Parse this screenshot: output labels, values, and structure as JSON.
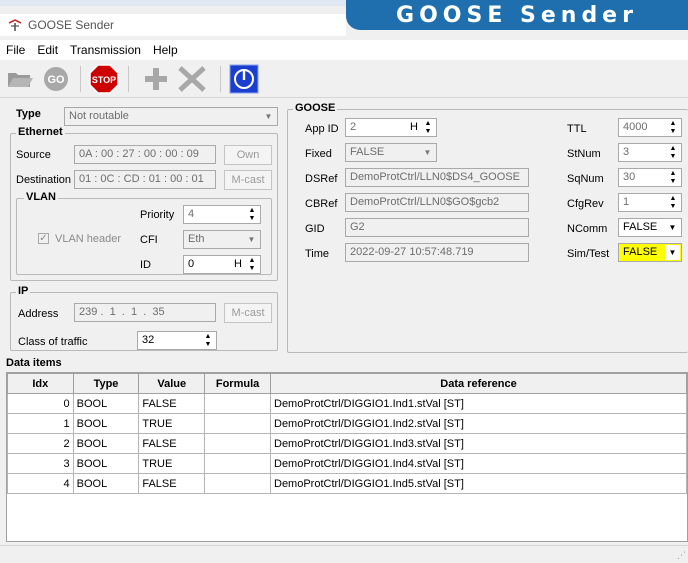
{
  "banner": "GOOSE Sender",
  "window_title": "GOOSE Sender",
  "menu": [
    "File",
    "Edit",
    "Transmission",
    "Help"
  ],
  "toolbar": {
    "open": "folder-open-icon",
    "go_label": "GO",
    "stop_label": "STOP",
    "add": "plus-icon",
    "remove": "x-icon",
    "power": "power-icon"
  },
  "type": {
    "label": "Type",
    "value": "Not routable"
  },
  "ethernet": {
    "title": "Ethernet",
    "source_label": "Source",
    "source_value": "0A : 00 : 27 : 00 : 00 : 09",
    "own_button": "Own",
    "destination_label": "Destination",
    "destination_value": "01 : 0C : CD : 01 : 00 : 01",
    "mcast_button": "M-cast"
  },
  "vlan": {
    "title": "VLAN",
    "header_label": "VLAN header",
    "priority_label": "Priority",
    "priority_value": "4",
    "cfi_label": "CFI",
    "cfi_value": "Eth",
    "id_label": "ID",
    "id_value": "0",
    "id_suffix": "H"
  },
  "ip": {
    "title": "IP",
    "address_label": "Address",
    "address_value": "239 .  1  .  1  .  35",
    "mcast_button": "M-cast",
    "class_label": "Class of traffic",
    "class_value": "32"
  },
  "goose": {
    "title": "GOOSE",
    "appid_label": "App ID",
    "appid_value": "2",
    "appid_suffix": "H",
    "fixed_label": "Fixed",
    "fixed_value": "FALSE",
    "dsref_label": "DSRef",
    "dsref_value": "DemoProtCtrl/LLN0$DS4_GOOSE",
    "cbref_label": "CBRef",
    "cbref_value": "DemoProtCtrl/LLN0$GO$gcb2",
    "gid_label": "GID",
    "gid_value": "G2",
    "time_label": "Time",
    "time_value": "2022-09-27 10:57:48.719",
    "ttl_label": "TTL",
    "ttl_value": "4000",
    "stnum_label": "StNum",
    "stnum_value": "3",
    "sqnum_label": "SqNum",
    "sqnum_value": "30",
    "cfgrev_label": "CfgRev",
    "cfgrev_value": "1",
    "ncomm_label": "NComm",
    "ncomm_value": "FALSE",
    "simtest_label": "Sim/Test",
    "simtest_value": "FALSE"
  },
  "data_items": {
    "title": "Data items",
    "columns": [
      "Idx",
      "Type",
      "Value",
      "Formula",
      "Data reference"
    ],
    "rows": [
      {
        "idx": "0",
        "type": "BOOL",
        "value": "FALSE",
        "formula": "",
        "ref": "DemoProtCtrl/DIGGIO1.Ind1.stVal [ST]"
      },
      {
        "idx": "1",
        "type": "BOOL",
        "value": "TRUE",
        "formula": "",
        "ref": "DemoProtCtrl/DIGGIO1.Ind2.stVal [ST]"
      },
      {
        "idx": "2",
        "type": "BOOL",
        "value": "FALSE",
        "formula": "",
        "ref": "DemoProtCtrl/DIGGIO1.Ind3.stVal [ST]"
      },
      {
        "idx": "3",
        "type": "BOOL",
        "value": "TRUE",
        "formula": "",
        "ref": "DemoProtCtrl/DIGGIO1.Ind4.stVal [ST]"
      },
      {
        "idx": "4",
        "type": "BOOL",
        "value": "FALSE",
        "formula": "",
        "ref": "DemoProtCtrl/DIGGIO1.Ind5.stVal [ST]"
      }
    ]
  },
  "colors": {
    "banner": "#1f6fae",
    "stop": "#cc0000",
    "power": "#1a3fcf",
    "highlight": "#ffff00"
  }
}
